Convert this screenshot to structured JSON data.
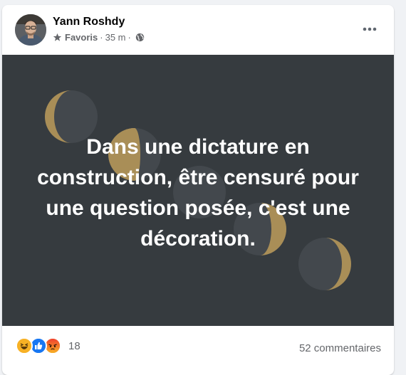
{
  "post": {
    "author": "Yann Roshdy",
    "audience_label": "Favoris",
    "separator": "·",
    "time": "35 m",
    "text": "Dans une dictature en construction, être censuré pour une question posée, c'est une décoration.",
    "background_color": "#363b3f",
    "accent_color": "#a98e57"
  },
  "icons": {
    "audience": "star-icon",
    "privacy": "globe-icon",
    "menu": "more-dots-icon"
  },
  "reactions": {
    "icons": [
      "haha-icon",
      "like-icon",
      "angry-icon"
    ],
    "count": "18"
  },
  "comments": {
    "label": "52 commentaires"
  }
}
